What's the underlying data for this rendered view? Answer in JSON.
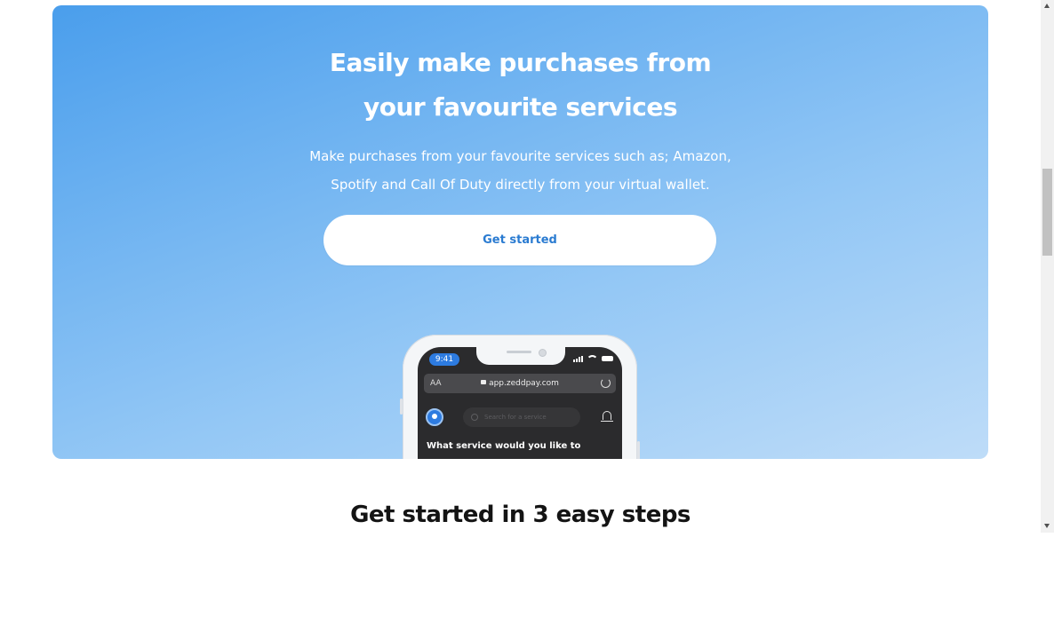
{
  "hero": {
    "title_line1": "Easily make purchases from",
    "title_line2": "your favourite services",
    "subtitle_line1": "Make purchases from your favourite services such as; Amazon,",
    "subtitle_line2": "Spotify and Call Of Duty directly from your virtual wallet.",
    "cta_label": "Get started",
    "gradient_start": "#4a9eec",
    "gradient_end": "#bedcf8",
    "cta_text_color": "#2a7bd1"
  },
  "phone": {
    "status_time": "9:41",
    "url_aa": "AA",
    "url": "app.zeddpay.com",
    "search_placeholder": "Search for a service",
    "question": "What service would you like to",
    "icons": [
      "lock-icon",
      "reload-icon",
      "avatar-icon",
      "search-icon",
      "bell-icon",
      "signal-icon",
      "wifi-icon",
      "battery-icon"
    ]
  },
  "steps": {
    "title": "Get started in 3 easy steps"
  },
  "scrollbar": {
    "icons": [
      "scroll-up-arrow-icon",
      "scroll-down-arrow-icon"
    ]
  }
}
